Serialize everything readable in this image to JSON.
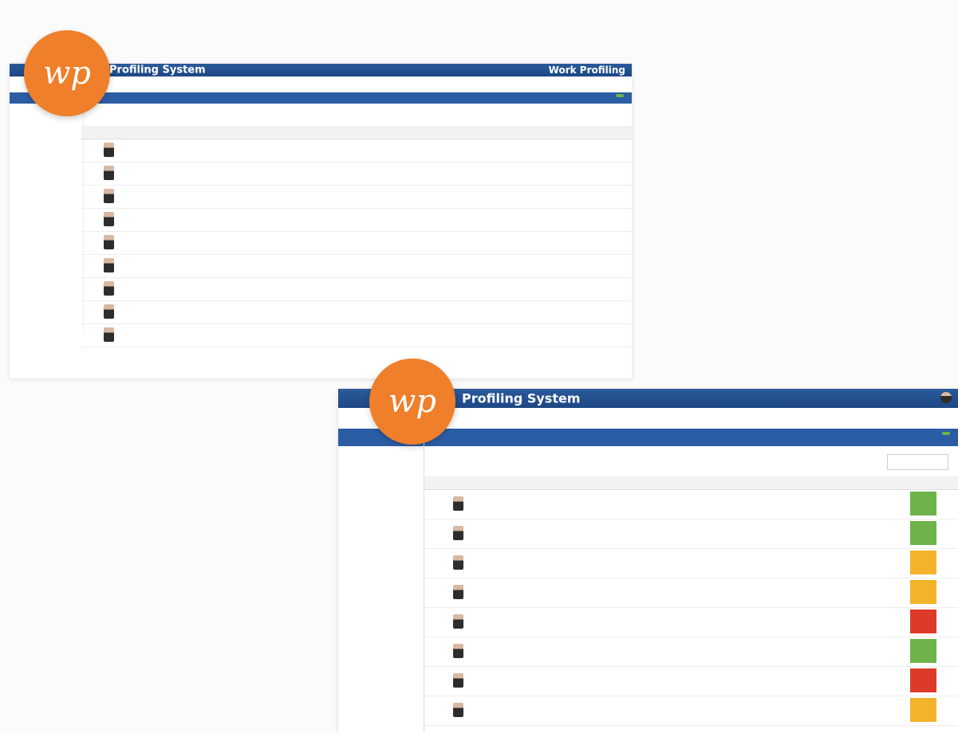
{
  "screen1": {
    "title": "Profiling System",
    "brand": "Work Profiling"
  },
  "screen2": {
    "title": "Profiling System"
  },
  "logo": {
    "text": "wp"
  },
  "colors": {
    "orange": "#ef7f2a",
    "blue": "#2b5da5",
    "green": "#6fb24a",
    "yellow": "#f3b32a",
    "red": "#dd3b2a"
  }
}
